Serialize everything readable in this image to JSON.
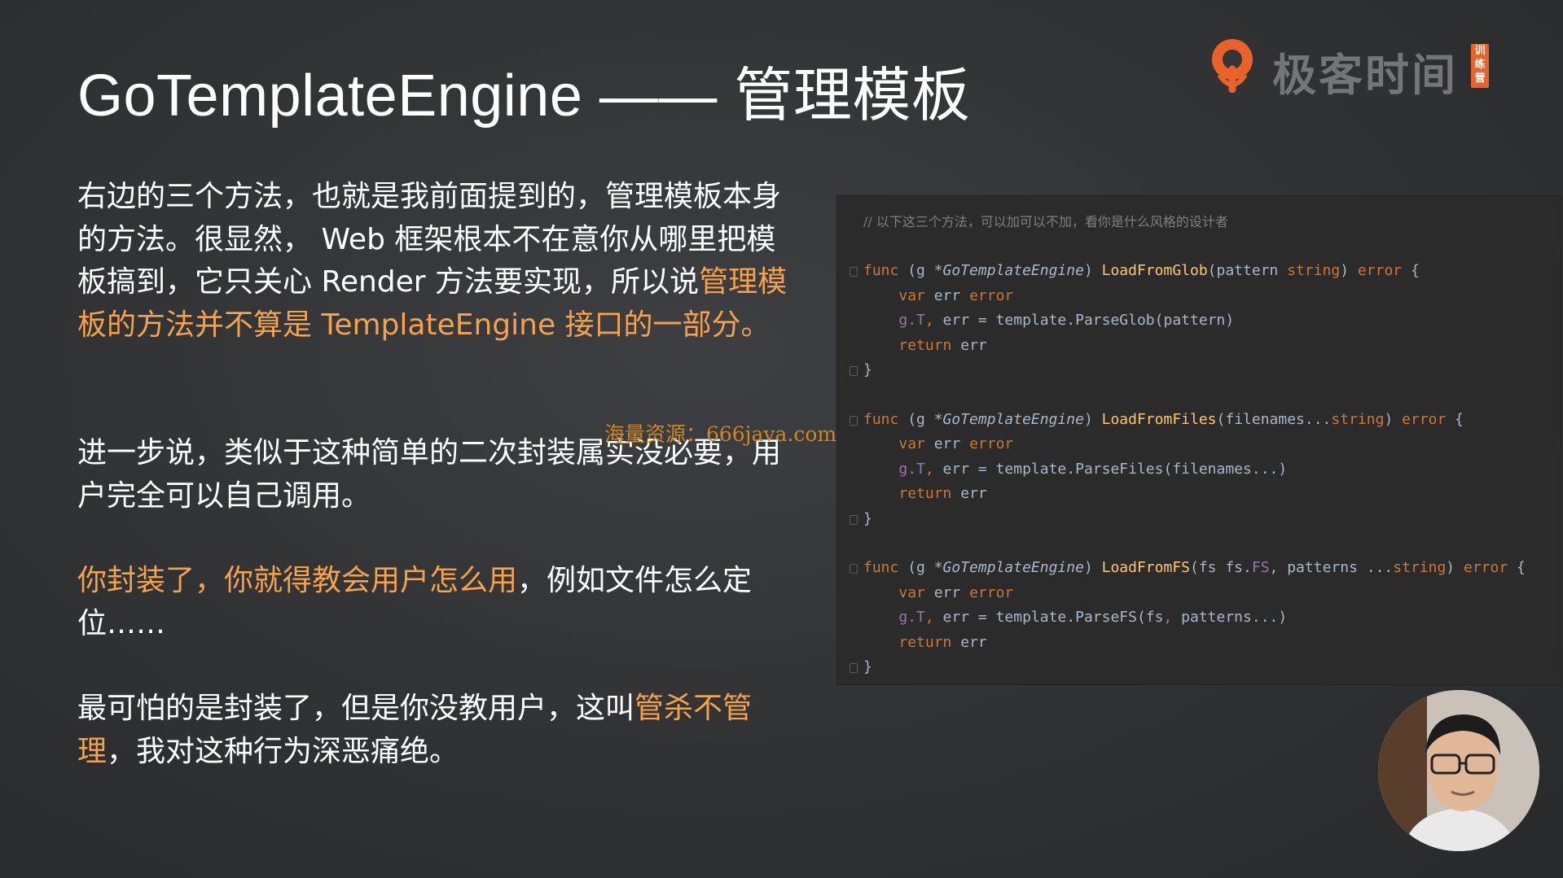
{
  "slide": {
    "title": "GoTemplateEngine —— 管理模板",
    "brand": {
      "name": "极客时间",
      "tag": "训练营",
      "tag_color": "#e8622a",
      "logo_icon": "geektime-logo-icon"
    },
    "paragraphs": [
      [
        {
          "text": "右边的三个方法，也就是我前面提到的，管理模板本身的方法。很显然， Web 框架根本不在意你从哪里把模板搞到，它只关心 Render 方法要实现，所以说",
          "highlight": false
        },
        {
          "text": "管理模板的方法并不算是 TemplateEngine 接口的一部分。",
          "highlight": true
        }
      ],
      [
        {
          "text": "进一步说，类似于这种简单的二次封装属实没必要，用户完全可以自己调用。",
          "highlight": false
        }
      ],
      [
        {
          "text": "你封装了，你就得教会用户怎么用",
          "highlight": true
        },
        {
          "text": "，例如文件怎么定位……",
          "highlight": false
        }
      ],
      [
        {
          "text": "最可怕的是封装了，但是你没教用户，这叫",
          "highlight": false
        },
        {
          "text": "管杀不管理",
          "highlight": true
        },
        {
          "text": "，我对这种行为深恶痛绝。",
          "highlight": false
        }
      ]
    ],
    "highlight_color": "#f5a24b",
    "watermark": "海量资源：666java.com"
  },
  "code": {
    "comment": "// 以下这三个方法，可以加可以不加，看你是什么风格的设计者",
    "funcs": [
      {
        "name": "LoadFromGlob",
        "params": "pattern string",
        "call": "ParseGlob",
        "args": "pattern"
      },
      {
        "name": "LoadFromFiles",
        "params": "filenames...string",
        "call": "ParseFiles",
        "args": "filenames..."
      },
      {
        "name": "LoadFromFS",
        "params": "fs fs.FS, patterns ...string",
        "call": "ParseFS",
        "args": "fs, patterns..."
      }
    ],
    "receiver": "g *GoTemplateEngine",
    "colors": {
      "keyword": "#cc7832",
      "function": "#ffc66d",
      "text": "#a9b7c6",
      "comment": "#808080",
      "field": "#9876aa"
    }
  },
  "presenter": {
    "avatar_icon": "presenter-avatar"
  }
}
